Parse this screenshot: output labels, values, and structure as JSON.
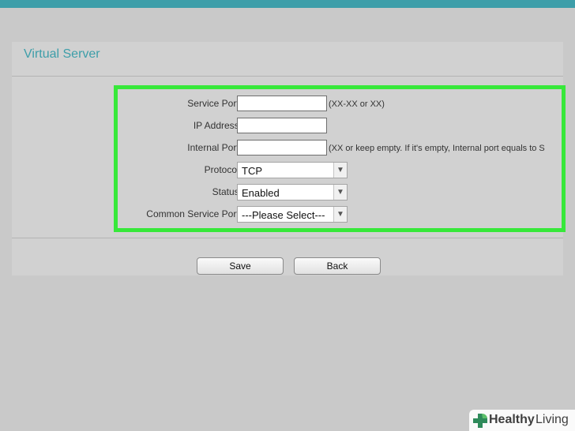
{
  "panel": {
    "title": "Virtual Server"
  },
  "form": {
    "service_port": {
      "label": "Service Port:",
      "value": "",
      "hint": "(XX-XX or XX)"
    },
    "ip_address": {
      "label": "IP Address:",
      "value": ""
    },
    "internal_port": {
      "label": "Internal Port:",
      "value": "",
      "hint": "(XX or keep empty. If it's empty, Internal port equals to S"
    },
    "protocol": {
      "label": "Protocol:",
      "selected": "TCP"
    },
    "status": {
      "label": "Status:",
      "selected": "Enabled"
    },
    "common_service_port": {
      "label": "Common Service Port:",
      "selected": "---Please Select---"
    }
  },
  "buttons": {
    "save": "Save",
    "back": "Back"
  },
  "watermark": {
    "word1": "Healthy",
    "word2": "Living"
  },
  "colors": {
    "header_bar": "#3d9ea9",
    "highlight_border": "#37e83a",
    "title": "#3d9ea9"
  },
  "icons": {
    "dropdown": "chevron-down-icon",
    "watermark": "medical-cross-leaf-icon"
  }
}
